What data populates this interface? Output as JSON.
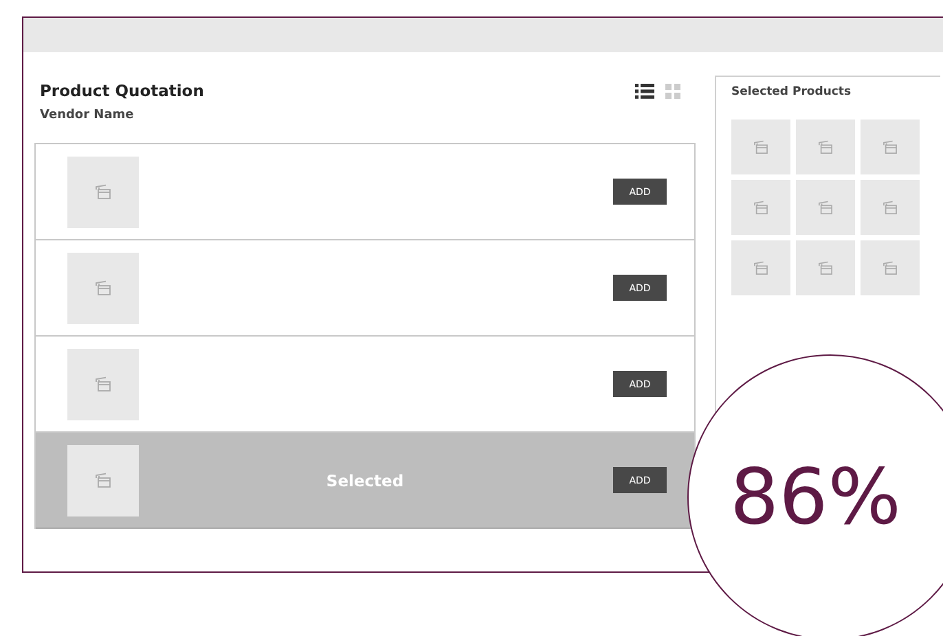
{
  "title": "Product Quotation",
  "vendor_label": "Vendor Name",
  "view_modes": [
    {
      "kind": "list",
      "selected": true
    },
    {
      "kind": "grid",
      "selected": false
    }
  ],
  "products": [
    {
      "selected": false,
      "button": "ADD"
    },
    {
      "selected": false,
      "button": "ADD"
    },
    {
      "selected": false,
      "button": "ADD"
    },
    {
      "selected": true,
      "label": "Selected",
      "button": "ADD"
    }
  ],
  "selected_panel": {
    "title": "Selected Products",
    "items": [
      {
        "kind": "placeholder"
      },
      {
        "kind": "placeholder"
      },
      {
        "kind": "placeholder"
      },
      {
        "kind": "placeholder"
      },
      {
        "kind": "placeholder"
      },
      {
        "kind": "placeholder"
      },
      {
        "kind": "placeholder"
      },
      {
        "kind": "placeholder"
      },
      {
        "kind": "placeholder"
      }
    ]
  },
  "zoom_badge": "86%"
}
